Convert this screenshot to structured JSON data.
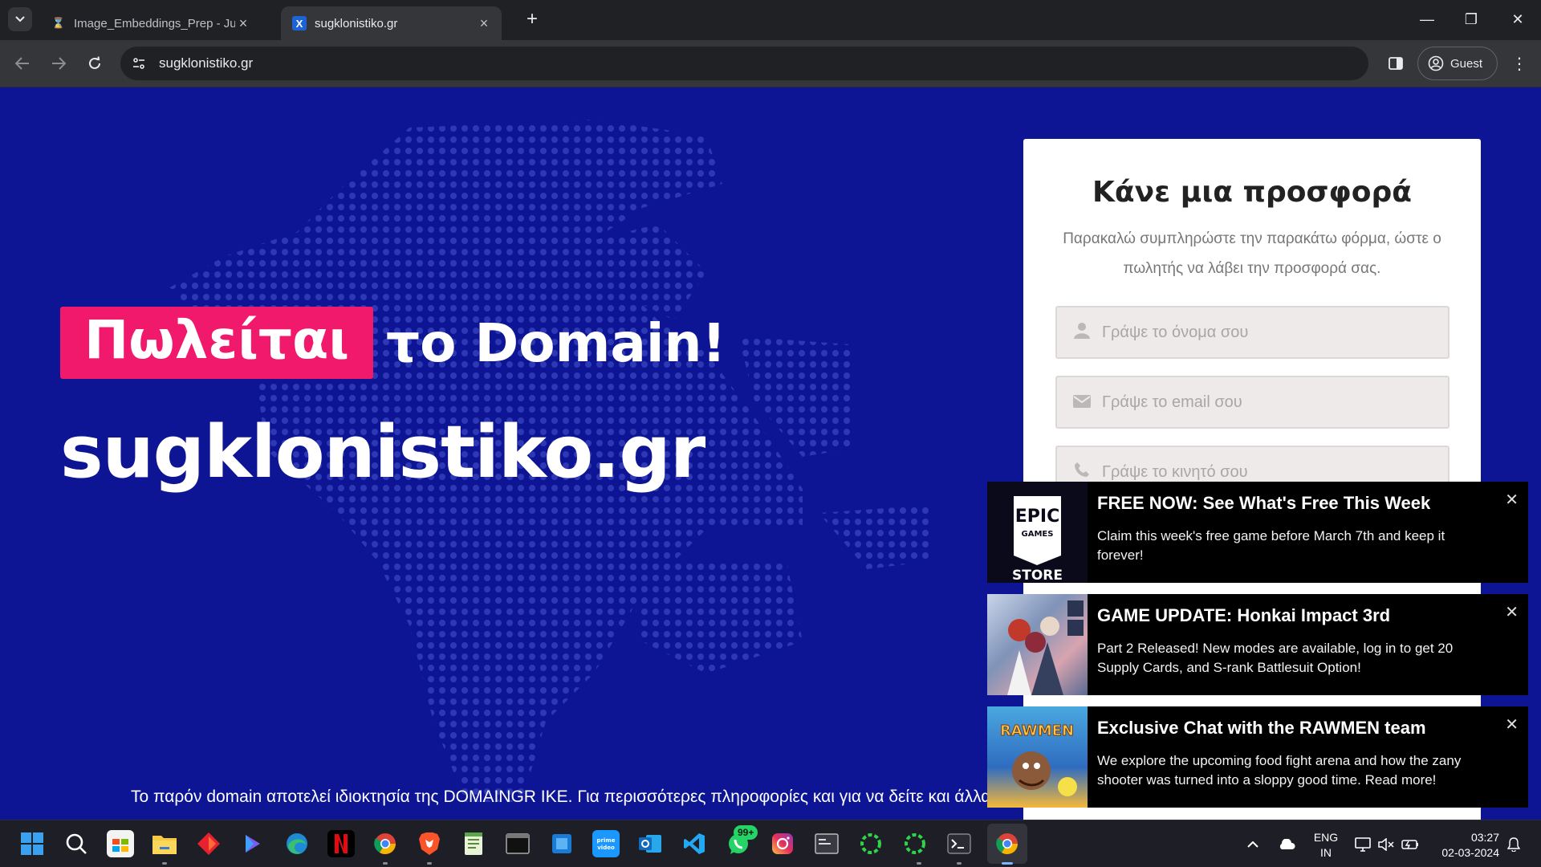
{
  "browser": {
    "tabs": [
      {
        "title": "Image_Embeddings_Prep - Jupy",
        "active": false
      },
      {
        "title": "sugklonistiko.gr",
        "active": true
      }
    ],
    "new_tab": "+",
    "url": "sugklonistiko.gr",
    "profile_label": "Guest",
    "window_controls": {
      "minimize": "—",
      "restore": "❐",
      "close": "✕"
    }
  },
  "page": {
    "sale_badge": "Πωλείται",
    "headline_rest": "το Domain!",
    "domain": "sugklonistiko.gr",
    "footer": "Το παρόν domain αποτελεί ιδιοκτησία της DOMAINGR IKE. Για περισσότερες πληροφορίες και για να δείτε και άλλα domains",
    "offer_form": {
      "title": "Κάνε μια προσφορά",
      "subtitle": "Παρακαλώ συμπληρώστε την παρακάτω φόρμα, ώστε ο πωλητής να λάβει την προσφορά σας.",
      "name_placeholder": "Γράψε το όνομα σου",
      "email_placeholder": "Γράψε το email σου",
      "phone_placeholder": "Γράψε το κινητό σου"
    }
  },
  "notifications": [
    {
      "title": "FREE NOW: See What's Free This Week",
      "text": "Claim this week's free game before March 7th and keep it forever!",
      "image": "epic-games-store-logo",
      "logo_text_1": "EPIC",
      "logo_text_2": "GAMES",
      "logo_text_3": "STORE"
    },
    {
      "title": "GAME UPDATE: Honkai Impact 3rd",
      "text": "Part 2 Released! New modes are available, log in to get 20 Supply Cards, and S-rank Battlesuit Option!",
      "image": "honkai-characters-art"
    },
    {
      "title": "Exclusive Chat with the RAWMEN team",
      "text": "We explore the upcoming food fight arena and how the zany shooter was turned into a sloppy good time. Read more!",
      "image": "rawmen-key-art",
      "logo_text_1": "RAWMEN"
    }
  ],
  "taskbar": {
    "apps": [
      "start",
      "search",
      "microsoft-store",
      "file-explorer",
      "app-red",
      "copilot",
      "edge",
      "netflix",
      "chrome",
      "brave",
      "notepad",
      "terminal",
      "windows-app",
      "prime-video",
      "outlook",
      "vscode",
      "whatsapp",
      "instagram",
      "app-window",
      "spinner-app",
      "spinner-app-2",
      "powershell",
      "chrome-active"
    ],
    "whatsapp_badge": "99+",
    "language": "ENG",
    "region": "IN",
    "time": "03:27",
    "date": "02-03-2024"
  }
}
